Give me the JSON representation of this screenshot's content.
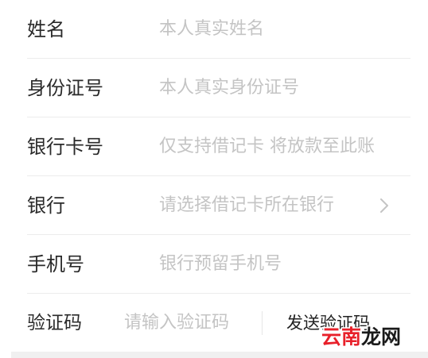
{
  "form": {
    "name": {
      "label": "姓名",
      "placeholder": "本人真实姓名"
    },
    "id_number": {
      "label": "身份证号",
      "placeholder": "本人真实身份证号"
    },
    "card_number": {
      "label": "银行卡号",
      "placeholder": "仅支持借记卡 将放款至此账"
    },
    "bank": {
      "label": "银行",
      "placeholder": "请选择借记卡所在银行",
      "icon": "chevron-right-icon"
    },
    "phone": {
      "label": "手机号",
      "placeholder": "银行预留手机号"
    },
    "code": {
      "label": "验证码",
      "placeholder": "请输入验证码",
      "send_label": "发送验证码"
    }
  },
  "watermark": {
    "text": "云南龙网",
    "colors": {
      "first": "#e8202a",
      "second": "#1a1a1a",
      "outline": "#ffffff"
    }
  }
}
